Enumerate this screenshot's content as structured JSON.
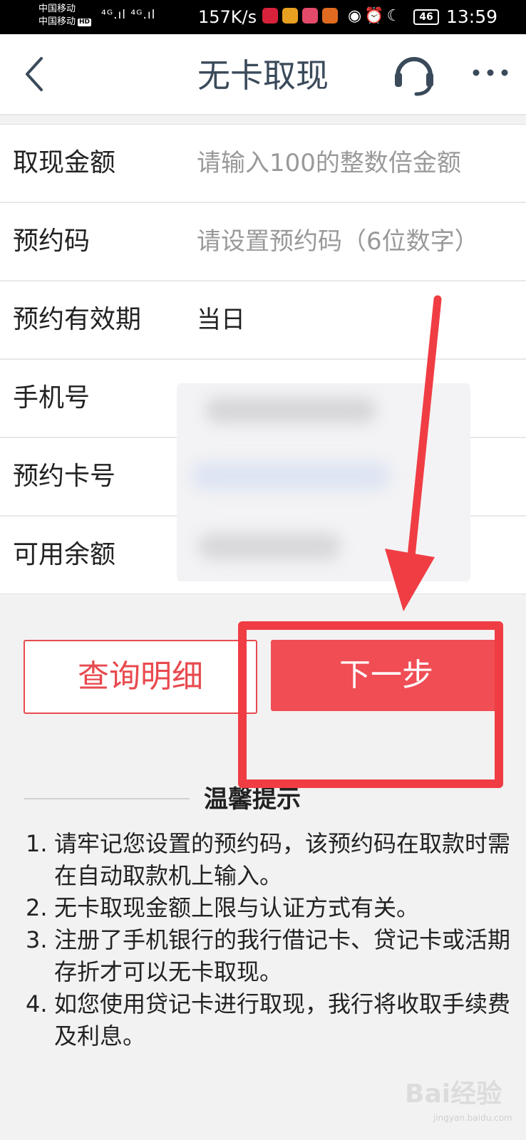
{
  "status_bar": {
    "carrier_1": "中国移动",
    "carrier_2": "中国移动",
    "hd_badge": "HD",
    "signal": "⁴ᴳ.ıl ⁴ᴳ.ıl",
    "net_speed": "157K/s",
    "status_icons": "◉⏰☾",
    "battery": "46",
    "time": "13:59",
    "app_icon_colors": [
      "#d8223b",
      "#e8a020",
      "#e34a6a",
      "#e06a20"
    ]
  },
  "header": {
    "title": "无卡取现",
    "back_icon": "chevron-left-icon",
    "support_icon": "headset-icon",
    "more_icon": "more-dots-icon"
  },
  "form": {
    "amount": {
      "label": "取现金额",
      "placeholder": "请输入100的整数倍金额"
    },
    "code": {
      "label": "预约码",
      "placeholder": "请设置预约码（6位数字）"
    },
    "validity": {
      "label": "预约有效期",
      "value": "当日"
    },
    "phone": {
      "label": "手机号"
    },
    "card": {
      "label": "预约卡号"
    },
    "balance": {
      "label": "可用余额"
    }
  },
  "buttons": {
    "query": "查询明细",
    "next": "下一步"
  },
  "tips": {
    "title": "温馨提示",
    "items": [
      {
        "num": "1.",
        "text": "请牢记您设置的预约码，该预约码在取款时需在自动取款机上输入。"
      },
      {
        "num": "2.",
        "text": "无卡取现金额上限与认证方式有关。"
      },
      {
        "num": "3.",
        "text": "注册了手机银行的我行借记卡、贷记卡或活期存折才可以无卡取现。"
      },
      {
        "num": "4.",
        "text": "如您使用贷记卡进行取现，我行将收取手续费及利息。"
      }
    ]
  },
  "watermark": {
    "text": "Bai经验",
    "sub": "jingyan.baidu.com"
  },
  "colors": {
    "accent_red": "#f04d55",
    "title_color": "#3a4a5a",
    "annotation_red": "#f03d44"
  }
}
